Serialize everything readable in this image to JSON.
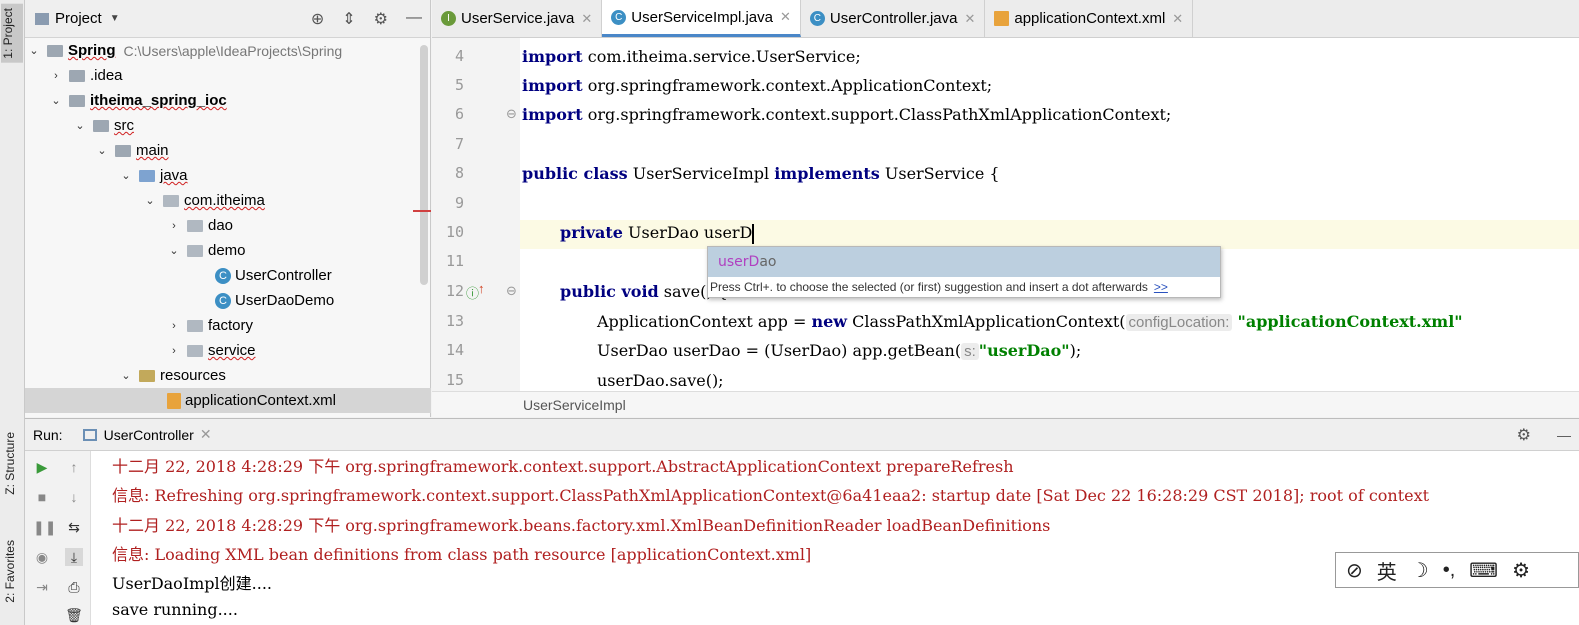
{
  "left_strip": {
    "tab_project": "1: Project",
    "tab_structure": "Z: Structure",
    "tab_favorites": "2: Favorites"
  },
  "project": {
    "title": "Project",
    "tree": [
      {
        "label": "Spring",
        "path": "C:\\Users\\apple\\IdeaProjects\\Spring"
      },
      {
        "label": ".idea"
      },
      {
        "label": "itheima_spring_ioc"
      },
      {
        "label": "src"
      },
      {
        "label": "main"
      },
      {
        "label": "java"
      },
      {
        "label": "com.itheima"
      },
      {
        "label": "dao"
      },
      {
        "label": "demo"
      },
      {
        "label": "UserController"
      },
      {
        "label": "UserDaoDemo"
      },
      {
        "label": "factory"
      },
      {
        "label": "service"
      },
      {
        "label": "resources"
      },
      {
        "label": "applicationContext.xml"
      }
    ]
  },
  "editor": {
    "tabs": [
      {
        "label": "UserService.java",
        "icon": "interface-icon"
      },
      {
        "label": "UserServiceImpl.java",
        "icon": "class-icon"
      },
      {
        "label": "UserController.java",
        "icon": "class-icon"
      },
      {
        "label": "applicationContext.xml",
        "icon": "xml-icon"
      }
    ],
    "line_numbers": [
      "4",
      "5",
      "6",
      "7",
      "8",
      "9",
      "10",
      "11",
      "12",
      "13",
      "14",
      "15"
    ],
    "lines": {
      "l4_kw": "import",
      "l4_rest": " com.itheima.service.UserService;",
      "l5_kw": "import",
      "l5_rest": " org.springframework.context.ApplicationContext;",
      "l6_kw": "import",
      "l6_rest": " org.springframework.context.support.ClassPathXmlApplicationContext;",
      "l8_kw1": "public class",
      "l8_mid": " UserServiceImpl ",
      "l8_kw2": "implements",
      "l8_rest": " UserService {",
      "l10_kw": "private",
      "l10_rest": " UserDao userD",
      "l12_kw": "public void",
      "l12_rest": " save() {",
      "l13_a": "ApplicationContext app = ",
      "l13_kw": "new",
      "l13_b": " ClassPathXmlApplicationContext(",
      "l13_hint": "configLocation:",
      "l13_str": "\"applicationContext.xml\"",
      "l14_a": "UserDao userDao = (UserDao) app.getBean(",
      "l14_hint": "s:",
      "l14_str": "\"userDao\"",
      "l14_b": ");",
      "l15_a": "userDao.save();"
    },
    "completion": {
      "item_match": "userD",
      "item_rest": "ao",
      "hint": "Press Ctrl+. to choose the selected (or first) suggestion and insert a dot afterwards",
      "hint_link": ">>"
    },
    "breadcrumb": "UserServiceImpl"
  },
  "run": {
    "label": "Run:",
    "tab": "UserController",
    "console": [
      {
        "text": "十二月 22, 2018 4:28:29 下午 org.springframework.context.support.AbstractApplicationContext prepareRefresh",
        "kind": "err"
      },
      {
        "text": "信息: Refreshing org.springframework.context.support.ClassPathXmlApplicationContext@6a41eaa2: startup date [Sat Dec 22 16:28:29 CST 2018]; root of context",
        "kind": "err"
      },
      {
        "text": "十二月 22, 2018 4:28:29 下午 org.springframework.beans.factory.xml.XmlBeanDefinitionReader loadBeanDefinitions",
        "kind": "err"
      },
      {
        "text": "信息: Loading XML bean definitions from class path resource [applicationContext.xml]",
        "kind": "err"
      },
      {
        "text": "UserDaoImpl创建....",
        "kind": "out"
      },
      {
        "text": "save running....",
        "kind": "out"
      }
    ]
  },
  "ime": {
    "mode": "英"
  },
  "colors": {
    "keyword": "#000080",
    "string": "#008000",
    "console_error": "#b02020",
    "active_tab_underline": "#4a87c8"
  }
}
